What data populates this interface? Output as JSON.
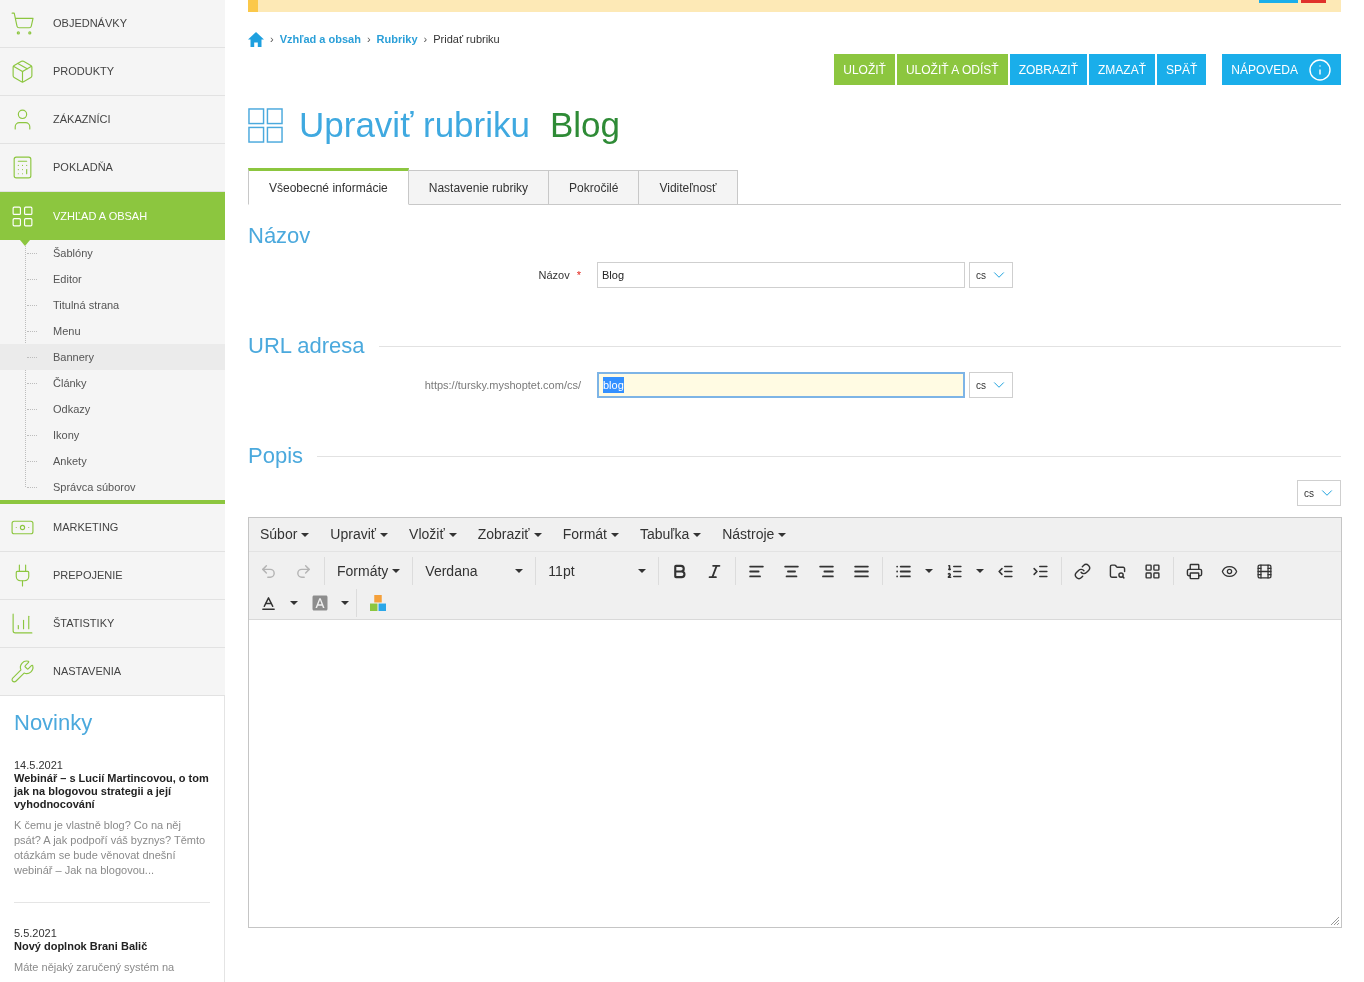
{
  "sidebar": {
    "items": [
      {
        "label": "OBJEDNÁVKY",
        "selected": false
      },
      {
        "label": "PRODUKTY",
        "selected": false
      },
      {
        "label": "ZÁKAZNÍCI",
        "selected": false
      },
      {
        "label": "POKLADŇA",
        "selected": false
      },
      {
        "label": "VZHĽAD A OBSAH",
        "selected": true,
        "expanded": true,
        "children": [
          {
            "label": "Šablóny",
            "selected": false
          },
          {
            "label": "Editor",
            "selected": false
          },
          {
            "label": "Titulná strana",
            "selected": false
          },
          {
            "label": "Menu",
            "selected": false
          },
          {
            "label": "Bannery",
            "selected": true
          },
          {
            "label": "Články",
            "selected": false
          },
          {
            "label": "Odkazy",
            "selected": false
          },
          {
            "label": "Ikony",
            "selected": false
          },
          {
            "label": "Ankety",
            "selected": false
          },
          {
            "label": "Správca súborov",
            "selected": false
          }
        ]
      },
      {
        "label": "MARKETING",
        "selected": false
      },
      {
        "label": "PREPOJENIE",
        "selected": false
      },
      {
        "label": "ŠTATISTIKY",
        "selected": false
      },
      {
        "label": "NASTAVENIA",
        "selected": false
      }
    ]
  },
  "news": {
    "title": "Novinky",
    "items": [
      {
        "date": "14.5.2021",
        "title": "Webinář – s Lucií Martincovou, o tom jak na blogovou strategii a její vyhodnocování",
        "excerpt": "K čemu je vlastně blog? Co na něj psát? A jak podpoří váš byznys? Těmto otázkám se bude věnovat dnešní webinář – Jak na blogovou..."
      },
      {
        "date": "5.5.2021",
        "title": "Nový doplnok Brani Balič",
        "excerpt": "Máte nějaký zaručený systém na"
      }
    ]
  },
  "banner": {
    "buttons": [
      {
        "color": "#1aaeea"
      },
      {
        "color": "#e0312b"
      }
    ]
  },
  "breadcrumb": [
    {
      "separator": "›",
      "label": "Vzhľad a obsah",
      "kind": "link"
    },
    {
      "separator": "›",
      "label": "Rubriky",
      "kind": "link"
    },
    {
      "separator": "›",
      "label": "Pridať rubriku",
      "kind": "current"
    }
  ],
  "actions": [
    {
      "label": "ULOŽIŤ",
      "kind": "save"
    },
    {
      "label": "ULOŽIŤ A ODÍSŤ",
      "kind": "save"
    },
    {
      "label": "ZOBRAZIŤ",
      "kind": "nav"
    },
    {
      "label": "ZMAZAŤ",
      "kind": "nav"
    },
    {
      "label": "SPÄŤ",
      "kind": "nav"
    },
    {
      "label": "NÁPOVEDA",
      "kind": "help"
    }
  ],
  "page_title": {
    "heading": "Upraviť rubriku",
    "name": "Blog"
  },
  "tabs": [
    {
      "label": "Všeobecné informácie",
      "selected": true
    },
    {
      "label": "Nastavenie rubriky",
      "selected": false
    },
    {
      "label": "Pokročilé",
      "selected": false
    },
    {
      "label": "Viditeľnosť",
      "selected": false
    }
  ],
  "sections": [
    {
      "title": "Názov",
      "kind": "field",
      "field": {
        "label": "Názov",
        "required_mark": "*",
        "value": "Blog",
        "focused": false,
        "text_selected": false,
        "language": "cs"
      }
    },
    {
      "title": "URL adresa",
      "kind": "field",
      "field": {
        "prefix": "https://tursky.myshoptet.com/cs/",
        "value": "blog",
        "focused": true,
        "text_selected": true,
        "language": "cs"
      }
    },
    {
      "title": "Popis",
      "kind": "editor",
      "language": "cs",
      "editor": {
        "menu": [
          {
            "label": "Súbor"
          },
          {
            "label": "Upraviť"
          },
          {
            "label": "Vložiť"
          },
          {
            "label": "Zobraziť"
          },
          {
            "label": "Formát"
          },
          {
            "label": "Tabuľka"
          },
          {
            "label": "Nástroje"
          }
        ],
        "toolbar": {
          "undo": {
            "disabled": true
          },
          "redo": {
            "disabled": true
          },
          "formats": "Formáty",
          "font": "Verdana",
          "size": "11pt"
        }
      }
    }
  ]
}
